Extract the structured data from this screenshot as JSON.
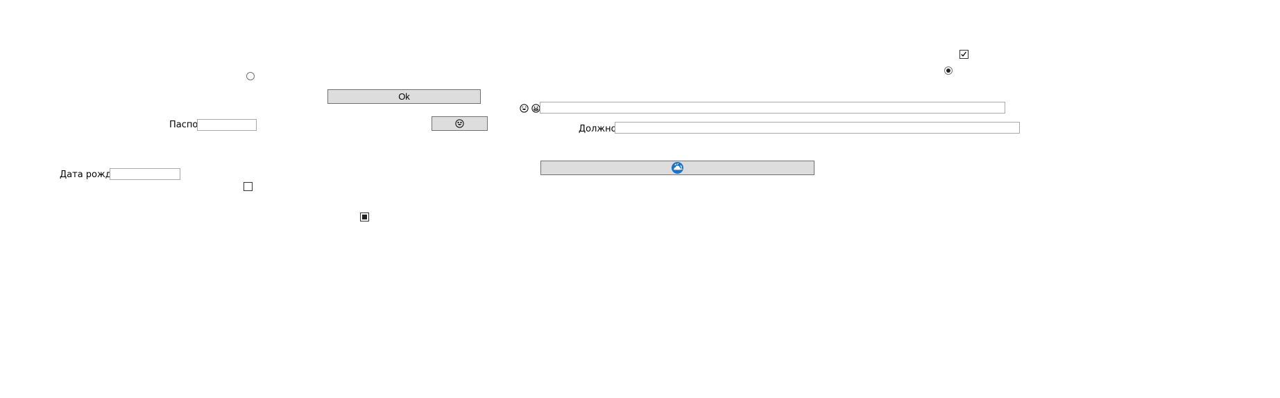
{
  "form": {
    "ok_label": "Ok",
    "passport_label": "Паспорт",
    "passport_value": "",
    "birthdate_label": "Дата рождения",
    "birthdate_value": "",
    "position_label": "Должность",
    "position_value": "",
    "top_text_value": "",
    "emoji_button_icon": "emoji-face-icon",
    "refresh_button_icon": "refresh-cloud-icon"
  },
  "states": {
    "radio_left_selected": false,
    "radio_right_selected": true,
    "checkbox_left_checked": false,
    "checkbox_mid_indeterminate": true,
    "checkbox_right_checked": true
  },
  "colors": {
    "button_face": "#dddddd",
    "button_border": "#707070",
    "textbox_border": "#a9a9a9",
    "refresh_icon": "#1a73c9"
  }
}
